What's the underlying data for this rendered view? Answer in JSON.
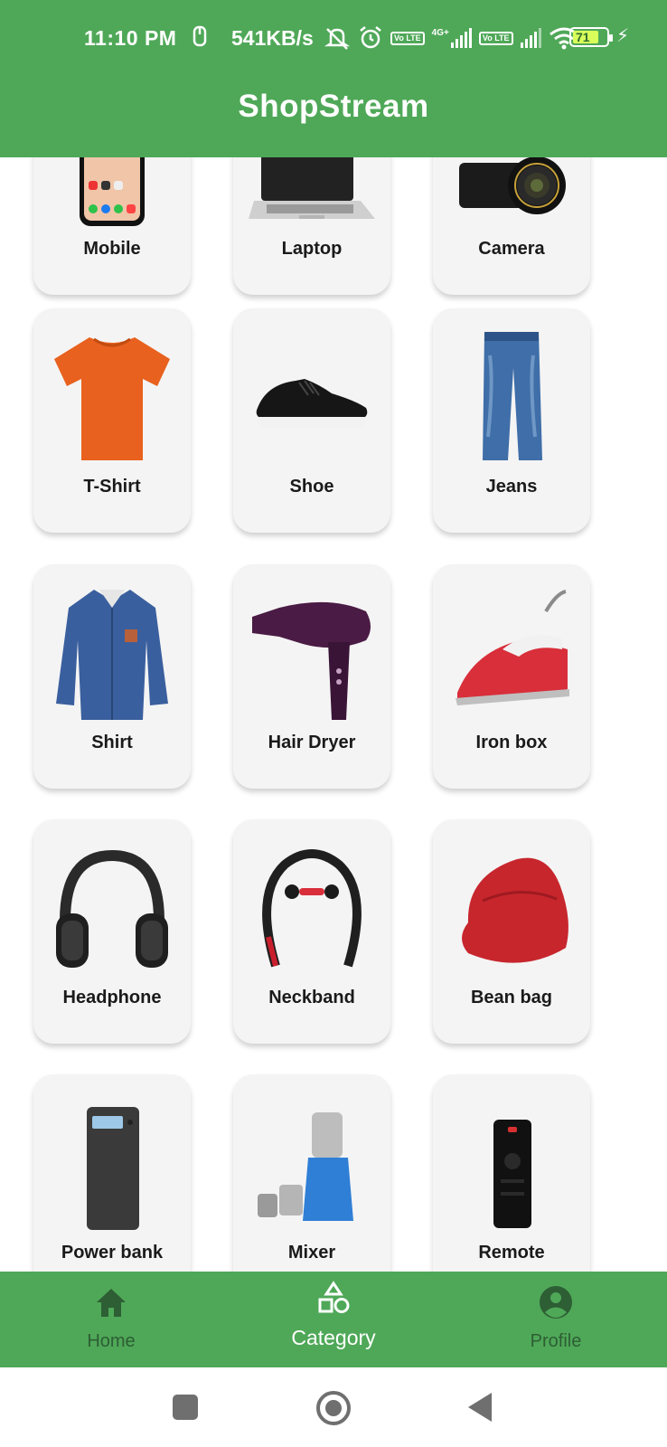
{
  "status_bar": {
    "time": "11:10 PM",
    "network_speed": "541KB/s",
    "battery_level": "71",
    "volte_1": "Vo LTE",
    "network_type": "4G+",
    "volte_2": "Vo LTE"
  },
  "app_bar": {
    "title": "ShopStream"
  },
  "categories": [
    {
      "label": "Mobile",
      "icon": "mobile-phone-image"
    },
    {
      "label": "Laptop",
      "icon": "laptop-image"
    },
    {
      "label": "Camera",
      "icon": "camera-image"
    },
    {
      "label": "T-Shirt",
      "icon": "tshirt-image"
    },
    {
      "label": "Shoe",
      "icon": "shoe-image"
    },
    {
      "label": "Jeans",
      "icon": "jeans-image"
    },
    {
      "label": "Shirt",
      "icon": "shirt-image"
    },
    {
      "label": "Hair Dryer",
      "icon": "hair-dryer-image"
    },
    {
      "label": "Iron box",
      "icon": "iron-box-image"
    },
    {
      "label": "Headphone",
      "icon": "headphone-image"
    },
    {
      "label": "Neckband",
      "icon": "neckband-image"
    },
    {
      "label": "Bean bag",
      "icon": "bean-bag-image"
    },
    {
      "label": "Power bank",
      "icon": "power-bank-image"
    },
    {
      "label": "Mixer",
      "icon": "mixer-image"
    },
    {
      "label": "Remote",
      "icon": "remote-image"
    }
  ],
  "bottom_nav": {
    "items": [
      {
        "label": "Home",
        "icon": "home-icon",
        "active": false
      },
      {
        "label": "Category",
        "icon": "category-icon",
        "active": true
      },
      {
        "label": "Profile",
        "icon": "profile-icon",
        "active": false
      }
    ]
  },
  "colors": {
    "primary": "#4fa858",
    "nav_inactive": "#2d5e34",
    "card_bg": "#f4f4f4"
  }
}
